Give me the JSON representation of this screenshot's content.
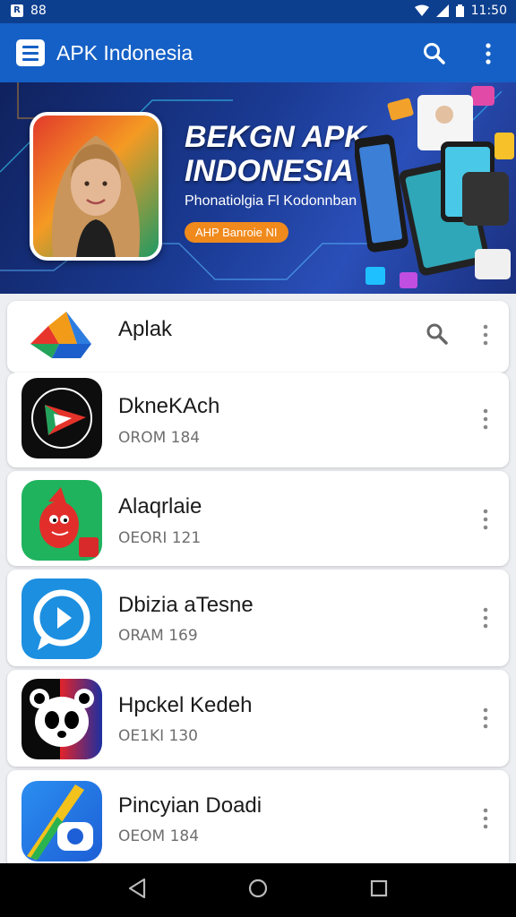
{
  "status_bar": {
    "left_text": "88",
    "time": "11:50"
  },
  "app_bar": {
    "title": "APK Indonesia"
  },
  "banner": {
    "headline_line1": "BEKGN APK",
    "headline_line2": "INDONESIA",
    "subtitle": "Phonatiolgia Fl Kodonnban",
    "pill_label": "AHP Banroie NI"
  },
  "header_row": {
    "title": "Aplak"
  },
  "apps": [
    {
      "name": "DkneKAch",
      "meta": "ORОМ 184"
    },
    {
      "name": "Alaqrlaie",
      "meta": "ОЕОRI 121"
    },
    {
      "name": "Dbizia aTesne",
      "meta": "ORAM 169"
    },
    {
      "name": "Hpckel Kedeh",
      "meta": "ОЕ1KI 130"
    },
    {
      "name": "Pincyian Doadi",
      "meta": "ОЕОМ 184"
    }
  ],
  "colors": {
    "primary": "#1560c6",
    "status": "#0d3f8f",
    "accent": "#f08a1c"
  }
}
